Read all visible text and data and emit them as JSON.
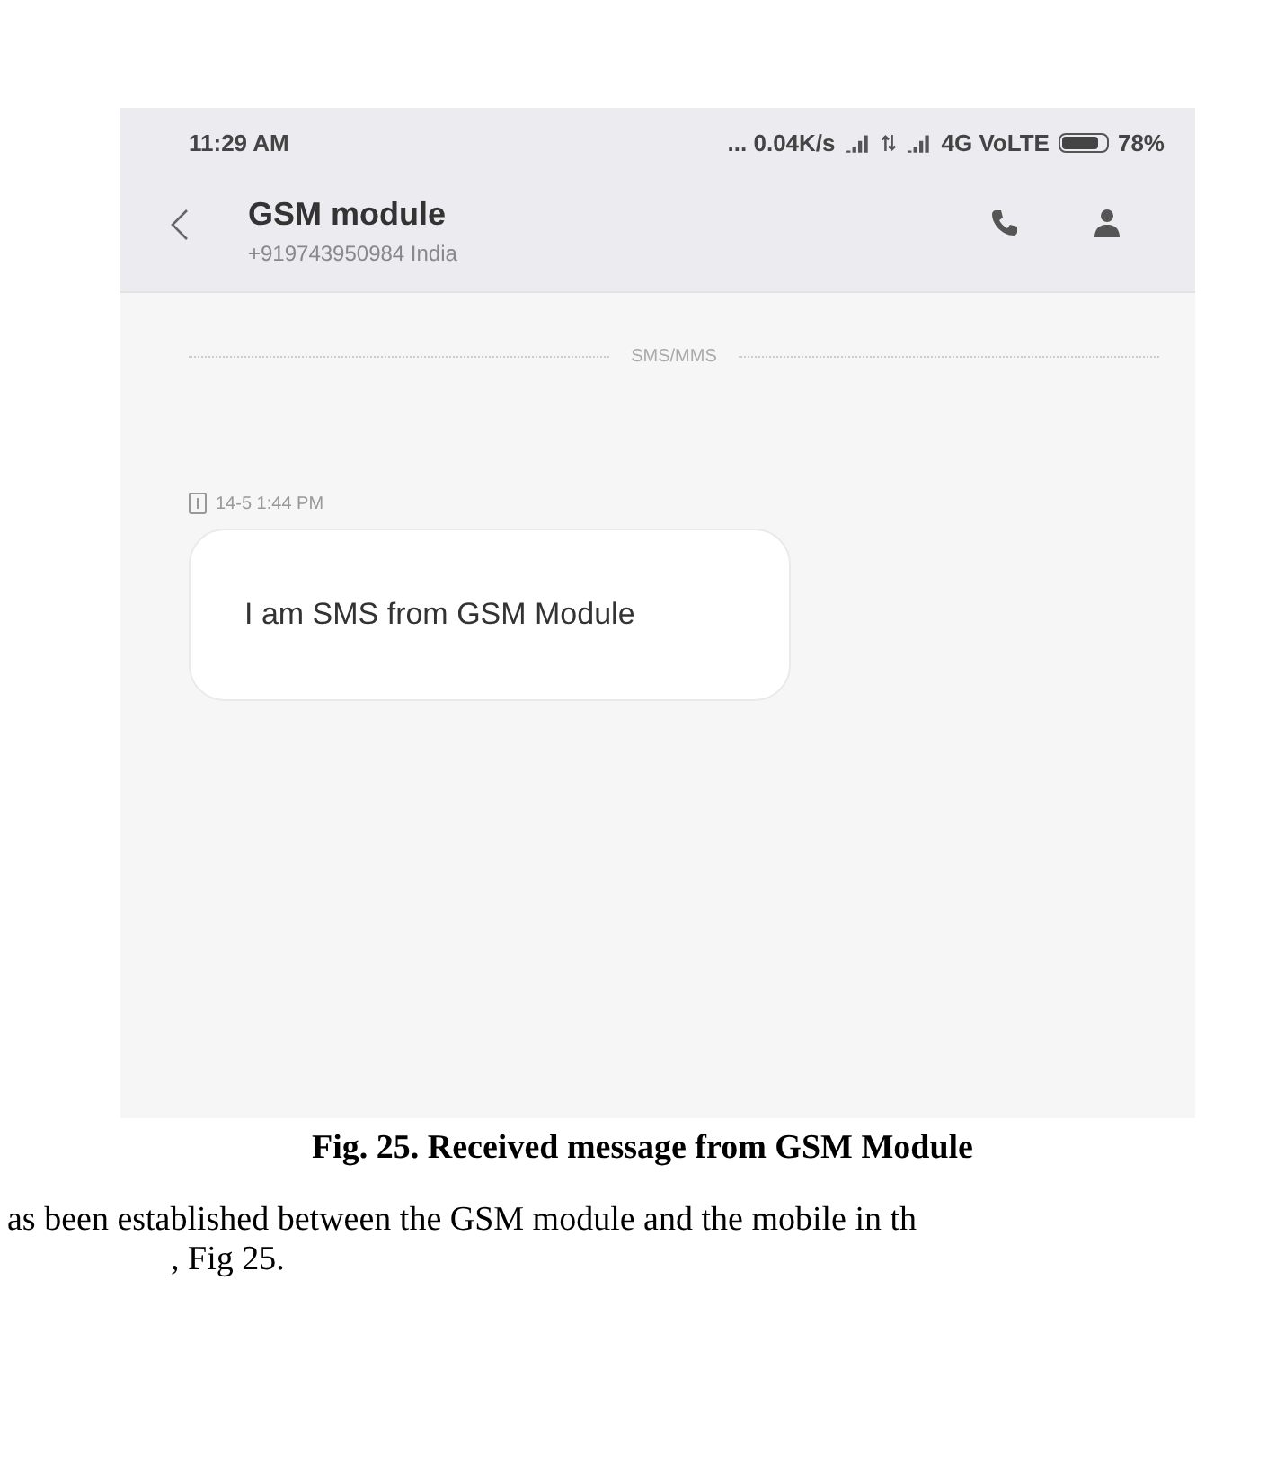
{
  "status_bar": {
    "time": "11:29 AM",
    "network_info": "... 0.04K/s",
    "network_type": "4G VoLTE",
    "battery_percent": "78%",
    "battery": {
      "level": 0.85
    }
  },
  "header": {
    "title": "GSM module",
    "subtitle": "+919743950984 India"
  },
  "thread": {
    "divider_label": "SMS/MMS",
    "messages": [
      {
        "timestamp": "14-5 1:44 PM",
        "text": "I am SMS from GSM Module"
      }
    ]
  },
  "caption": "Fig. 25. Received message from GSM Module",
  "body_text": [
    "as been established between the GSM module and the mobile in th",
    ", Fig 25."
  ]
}
